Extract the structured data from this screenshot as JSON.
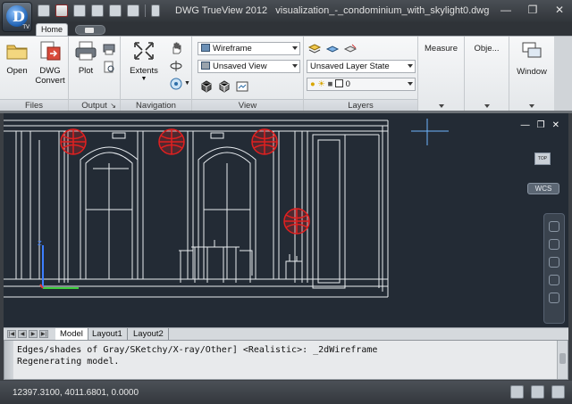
{
  "window": {
    "app_title": "DWG TrueView 2012",
    "file_name": "visualization_-_condominium_with_skylight0.dwg",
    "app_badge": "TV",
    "controls": [
      "minimize",
      "restore",
      "close"
    ]
  },
  "ribbon": {
    "tabs": [
      {
        "label": "Home",
        "active": true
      },
      {
        "label": "",
        "icon": "camera-icon"
      }
    ],
    "groups": {
      "files": {
        "label": "Files",
        "open": "Open",
        "dwg_convert": "DWG Convert"
      },
      "output": {
        "label": "Output",
        "plot": "Plot"
      },
      "navigation": {
        "label": "Navigation",
        "extents": "Extents"
      },
      "view": {
        "label": "View",
        "visual_style": "Wireframe",
        "named_view": "Unsaved View"
      },
      "layers": {
        "label": "Layers",
        "layer_state": "Unsaved Layer State",
        "current_layer": "0"
      },
      "measure": {
        "label": "Measure"
      },
      "objects": {
        "label": "Obje..."
      },
      "window": {
        "label": "Window"
      }
    }
  },
  "viewport": {
    "ucs_label": "WCS",
    "cube_label": "TOP",
    "background": "#232b35",
    "wire_color": "#e8ecf0",
    "light_marker_color": "#e02020"
  },
  "layout_tabs": [
    "Model",
    "Layout1",
    "Layout2"
  ],
  "command": {
    "line1": "Edges/shades of Gray/SKetchy/X-ray/Other] <Realistic>: _2dWireframe",
    "line2": "Regenerating model."
  },
  "status": {
    "coordinates": "12397.3100, 4011.6801, 0.0000"
  }
}
